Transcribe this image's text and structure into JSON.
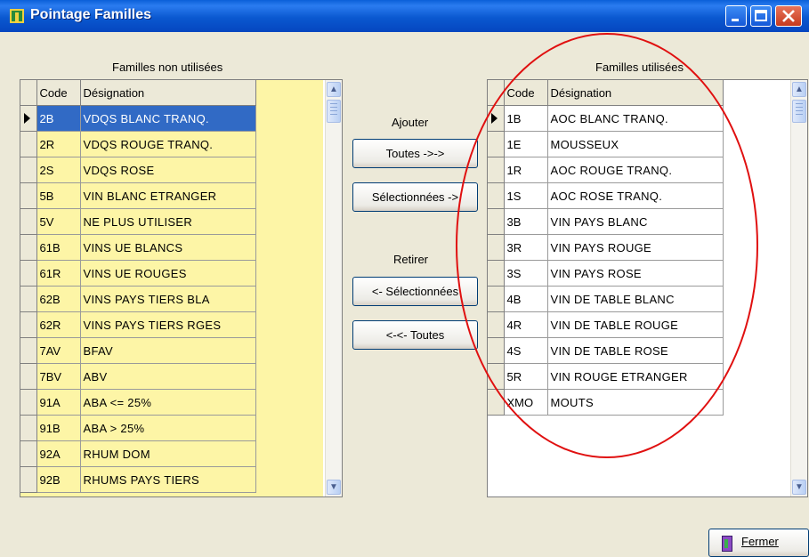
{
  "window": {
    "title": "Pointage Familles"
  },
  "left_panel": {
    "label": "Familles non utilisées",
    "columns": [
      "Code",
      "Désignation"
    ],
    "rows": [
      {
        "code": "2B",
        "designation": "VDQS BLANC TRANQ."
      },
      {
        "code": "2R",
        "designation": "VDQS ROUGE TRANQ."
      },
      {
        "code": "2S",
        "designation": "VDQS ROSE"
      },
      {
        "code": "5B",
        "designation": "VIN BLANC ETRANGER"
      },
      {
        "code": "5V",
        "designation": "NE PLUS UTILISER"
      },
      {
        "code": "61B",
        "designation": "VINS UE BLANCS"
      },
      {
        "code": "61R",
        "designation": "VINS UE ROUGES"
      },
      {
        "code": "62B",
        "designation": "VINS PAYS TIERS BLA"
      },
      {
        "code": "62R",
        "designation": "VINS PAYS TIERS RGES"
      },
      {
        "code": "7AV",
        "designation": "BFAV"
      },
      {
        "code": "7BV",
        "designation": "ABV"
      },
      {
        "code": "91A",
        "designation": "ABA <= 25%"
      },
      {
        "code": "91B",
        "designation": "ABA > 25%"
      },
      {
        "code": "92A",
        "designation": "RHUM DOM"
      },
      {
        "code": "92B",
        "designation": "RHUMS PAYS TIERS"
      }
    ]
  },
  "right_panel": {
    "label": "Familles utilisées",
    "columns": [
      "Code",
      "Désignation"
    ],
    "rows": [
      {
        "code": "1B",
        "designation": "AOC BLANC TRANQ."
      },
      {
        "code": "1E",
        "designation": "MOUSSEUX"
      },
      {
        "code": "1R",
        "designation": "AOC ROUGE TRANQ."
      },
      {
        "code": "1S",
        "designation": "AOC ROSE TRANQ."
      },
      {
        "code": "3B",
        "designation": "VIN PAYS BLANC"
      },
      {
        "code": "3R",
        "designation": "VIN PAYS ROUGE"
      },
      {
        "code": "3S",
        "designation": "VIN PAYS ROSE"
      },
      {
        "code": "4B",
        "designation": "VIN DE TABLE BLANC"
      },
      {
        "code": "4R",
        "designation": "VIN DE TABLE ROUGE"
      },
      {
        "code": "4S",
        "designation": "VIN DE TABLE ROSE"
      },
      {
        "code": "5R",
        "designation": "VIN ROUGE ETRANGER"
      },
      {
        "code": "XMO",
        "designation": "MOUTS"
      }
    ]
  },
  "actions": {
    "add_label": "Ajouter",
    "add_all": "Toutes ->->",
    "add_selected": "Sélectionnées ->",
    "remove_label": "Retirer",
    "remove_selected": "<- Sélectionnées",
    "remove_all": "<-<- Toutes"
  },
  "footer": {
    "close_label": "Fermer"
  },
  "colors": {
    "titlebar": "#0a58d0",
    "grid_bg": "#fdf5a6",
    "selection": "#316ac5",
    "annotation": "#e01010"
  },
  "icons": [
    "app-icon",
    "minimize-icon",
    "maximize-icon",
    "close-icon",
    "scroll-up-icon",
    "scroll-down-icon",
    "row-pointer-icon",
    "door-exit-icon"
  ]
}
